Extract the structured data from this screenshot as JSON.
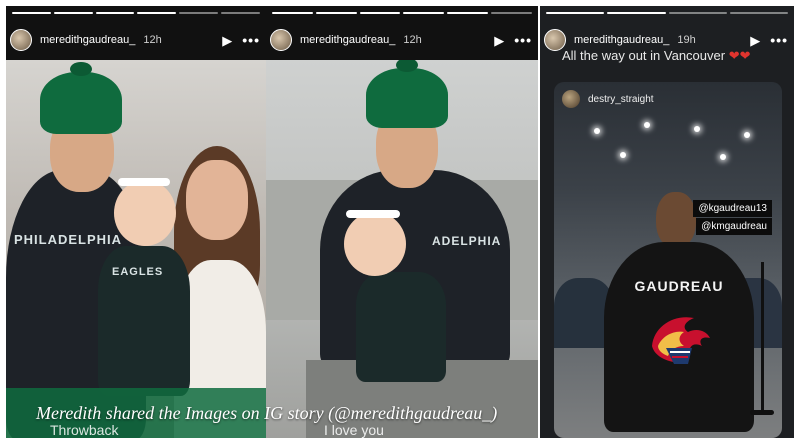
{
  "stories": [
    {
      "username": "meredithgaudreau_",
      "time": "12h",
      "overlay_text": "Throwback",
      "segments": 6
    },
    {
      "username": "meredithgaudreau_",
      "time": "12h",
      "overlay_text": "I love you",
      "segments": 6
    },
    {
      "username": "meredithgaudreau_",
      "time": "19h",
      "caption": "All the way out in Vancouver",
      "caption_emoji": "❤❤",
      "repost": {
        "username": "destry_straight",
        "mentions": [
          "@kgaudreau13",
          "@kmgaudreau"
        ],
        "jacket_name": "GAUDREAU"
      }
    }
  ],
  "shirt_text": {
    "man_hoodie": "PHILADELPHIA",
    "baby_onesie": "EAGLES",
    "man_hoodie_2": "ADELPHIA"
  },
  "article_caption": "Meredith shared the Images on IG story (@meredithgaudreau_)",
  "colors": {
    "eagles_green": "#0f6b3e",
    "flames_red": "#c8102e",
    "heart": "#e0342e"
  },
  "icons": {
    "play": "play-icon",
    "more": "more-options-icon"
  }
}
